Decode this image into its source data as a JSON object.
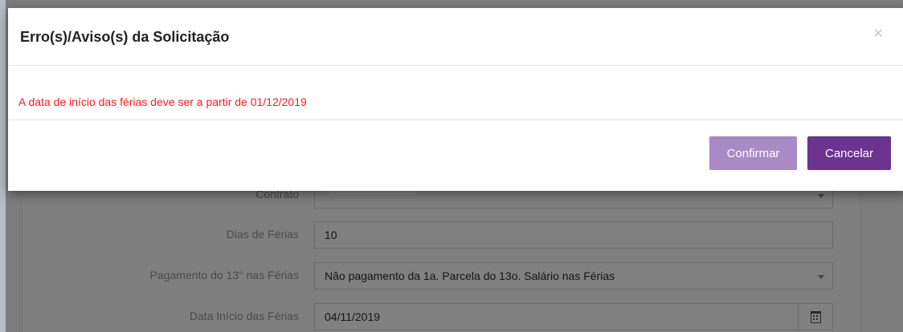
{
  "modal": {
    "title": "Erro(s)/Aviso(s) da Solicitação",
    "close_icon": "×",
    "message": "A data de início das férias deve ser a partir de 01/12/2019",
    "confirm_label": "Confirmar",
    "cancel_label": "Cancelar",
    "colors": {
      "message": "#ff1a1a",
      "confirm_button": "#a98ac6",
      "cancel_button": "#6c3391"
    }
  },
  "form": {
    "contrato": {
      "label": "Contrato",
      "value": ""
    },
    "dias_ferias": {
      "label": "Dias de Férias",
      "value": "10"
    },
    "pagamento_13": {
      "label": "Pagamento do 13° nas Férias",
      "value": "Não pagamento da 1a. Parcela do 13o. Salário nas Férias"
    },
    "data_inicio": {
      "label": "Data Início das Férias",
      "value": "04/11/2019",
      "icon": "calendar-icon"
    }
  }
}
